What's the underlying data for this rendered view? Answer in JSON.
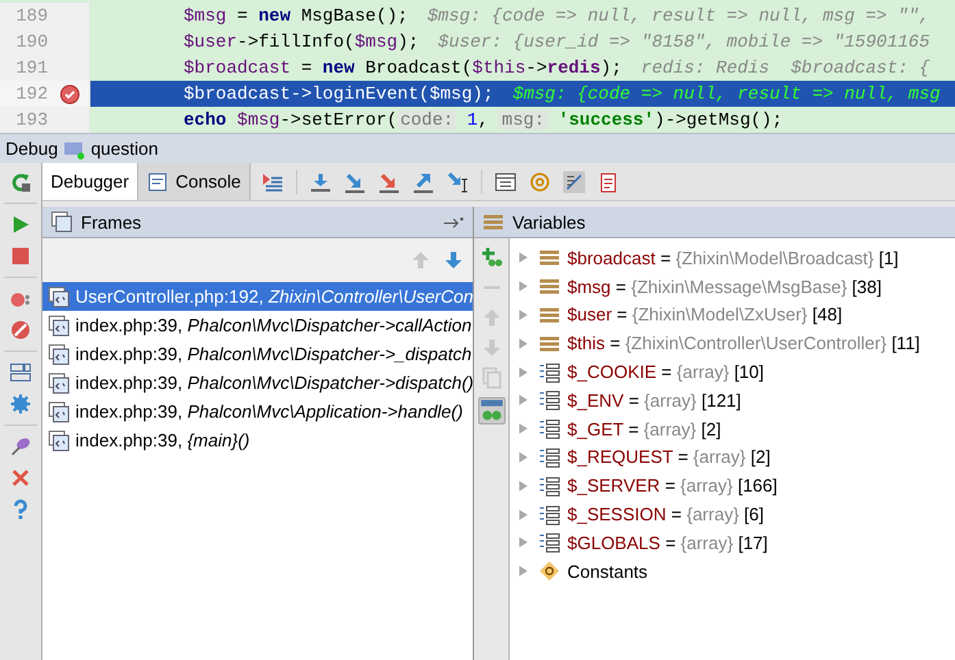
{
  "editor": {
    "lines": [
      {
        "number": "189",
        "breakpoint": false,
        "selected": false,
        "tokens": [
          {
            "t": "$msg",
            "kind": "var"
          },
          {
            "t": " = ",
            "kind": "plain"
          },
          {
            "t": "new",
            "kind": "kw"
          },
          {
            "t": " MsgBase();",
            "kind": "plain"
          }
        ],
        "hint": "$msg: {code => null, result => null, msg => \"\","
      },
      {
        "number": "190",
        "breakpoint": false,
        "selected": false,
        "tokens": [
          {
            "t": "$user",
            "kind": "var"
          },
          {
            "t": "->fillInfo(",
            "kind": "plain"
          },
          {
            "t": "$msg",
            "kind": "var"
          },
          {
            "t": ");",
            "kind": "plain"
          }
        ],
        "hint": "$user: {user_id => \"8158\", mobile => \"15901165"
      },
      {
        "number": "191",
        "breakpoint": false,
        "selected": false,
        "tokens": [
          {
            "t": "$broadcast",
            "kind": "var"
          },
          {
            "t": " = ",
            "kind": "plain"
          },
          {
            "t": "new",
            "kind": "kw"
          },
          {
            "t": " Broadcast(",
            "kind": "plain"
          },
          {
            "t": "$this",
            "kind": "var"
          },
          {
            "t": "->",
            "kind": "plain"
          },
          {
            "t": "redis",
            "kind": "field"
          },
          {
            "t": ");",
            "kind": "plain"
          }
        ],
        "hint": "redis: Redis  $broadcast: {"
      },
      {
        "number": "192",
        "breakpoint": true,
        "selected": true,
        "tokens": [
          {
            "t": "$broadcast",
            "kind": "var"
          },
          {
            "t": "->loginEvent(",
            "kind": "plain"
          },
          {
            "t": "$msg",
            "kind": "var"
          },
          {
            "t": ");",
            "kind": "plain"
          }
        ],
        "hint": "$msg: {code => null, result => null, msg"
      },
      {
        "number": "193",
        "breakpoint": false,
        "selected": false,
        "tokens": [
          {
            "t": "echo",
            "kind": "kw"
          },
          {
            "t": " $msg",
            "kind": "var"
          },
          {
            "t": "->setError(",
            "kind": "plain"
          },
          {
            "t": "code:",
            "kind": "param"
          },
          {
            "t": " 1",
            "kind": "num"
          },
          {
            "t": ", ",
            "kind": "plain"
          },
          {
            "t": "msg:",
            "kind": "param"
          },
          {
            "t": " 'success'",
            "kind": "str"
          },
          {
            "t": ")->getMsg();",
            "kind": "plain"
          }
        ]
      }
    ]
  },
  "debug_bar": {
    "label": "Debug",
    "config": "question"
  },
  "tabs": [
    {
      "label": "Debugger",
      "selected": true
    },
    {
      "label": "Console",
      "selected": false
    }
  ],
  "frames": {
    "title": "Frames",
    "items": [
      {
        "file": "UserController.php:192,",
        "location": "Zhixin\\Controller\\UserCon",
        "selected": true
      },
      {
        "file": "index.php:39,",
        "location": "Phalcon\\Mvc\\Dispatcher->callAction",
        "selected": false
      },
      {
        "file": "index.php:39,",
        "location": "Phalcon\\Mvc\\Dispatcher->_dispatch",
        "selected": false
      },
      {
        "file": "index.php:39,",
        "location": "Phalcon\\Mvc\\Dispatcher->dispatch()",
        "selected": false
      },
      {
        "file": "index.php:39,",
        "location": "Phalcon\\Mvc\\Application->handle()",
        "selected": false
      },
      {
        "file": "index.php:39,",
        "location": "{main}()",
        "selected": false
      }
    ]
  },
  "variables": {
    "title": "Variables",
    "items": [
      {
        "kind": "object",
        "name": "$broadcast",
        "op": "=",
        "type": "{Zhixin\\Model\\Broadcast}",
        "count": "[1]"
      },
      {
        "kind": "object",
        "name": "$msg",
        "op": "=",
        "type": "{Zhixin\\Message\\MsgBase}",
        "count": "[38]"
      },
      {
        "kind": "object",
        "name": "$user",
        "op": "=",
        "type": "{Zhixin\\Model\\ZxUser}",
        "count": "[48]"
      },
      {
        "kind": "object",
        "name": "$this",
        "op": "=",
        "type": "{Zhixin\\Controller\\UserController}",
        "count": "[11]"
      },
      {
        "kind": "array",
        "name": "$_COOKIE",
        "op": "=",
        "type": "{array}",
        "count": "[10]"
      },
      {
        "kind": "array",
        "name": "$_ENV",
        "op": "=",
        "type": "{array}",
        "count": "[121]"
      },
      {
        "kind": "array",
        "name": "$_GET",
        "op": "=",
        "type": "{array}",
        "count": "[2]"
      },
      {
        "kind": "array",
        "name": "$_REQUEST",
        "op": "=",
        "type": "{array}",
        "count": "[2]"
      },
      {
        "kind": "array",
        "name": "$_SERVER",
        "op": "=",
        "type": "{array}",
        "count": "[166]"
      },
      {
        "kind": "array",
        "name": "$_SESSION",
        "op": "=",
        "type": "{array}",
        "count": "[6]"
      },
      {
        "kind": "array",
        "name": "$GLOBALS",
        "op": "=",
        "type": "{array}",
        "count": "[17]"
      },
      {
        "kind": "constants",
        "name": "Constants"
      }
    ]
  }
}
